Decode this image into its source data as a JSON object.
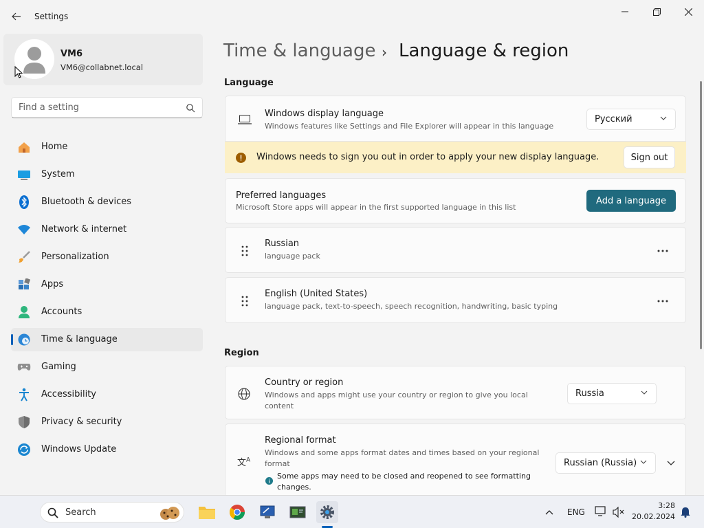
{
  "window": {
    "title": "Settings"
  },
  "user": {
    "name": "VM6",
    "email": "VM6@collabnet.local"
  },
  "search": {
    "placeholder": "Find a setting"
  },
  "sidebar": {
    "items": [
      {
        "label": "Home",
        "icon": "home-icon"
      },
      {
        "label": "System",
        "icon": "system-icon"
      },
      {
        "label": "Bluetooth & devices",
        "icon": "bluetooth-icon"
      },
      {
        "label": "Network & internet",
        "icon": "wifi-icon"
      },
      {
        "label": "Personalization",
        "icon": "brush-icon"
      },
      {
        "label": "Apps",
        "icon": "apps-icon"
      },
      {
        "label": "Accounts",
        "icon": "accounts-icon"
      },
      {
        "label": "Time & language",
        "icon": "time-language-icon",
        "active": true
      },
      {
        "label": "Gaming",
        "icon": "gamepad-icon"
      },
      {
        "label": "Accessibility",
        "icon": "accessibility-icon"
      },
      {
        "label": "Privacy & security",
        "icon": "shield-icon"
      },
      {
        "label": "Windows Update",
        "icon": "update-icon"
      }
    ]
  },
  "breadcrumb": {
    "parent": "Time & language",
    "separator": "›",
    "current": "Language & region"
  },
  "language": {
    "heading": "Language",
    "display": {
      "title": "Windows display language",
      "subtitle": "Windows features like Settings and File Explorer will appear in this language",
      "value": "Русский"
    },
    "warning": {
      "text": "Windows needs to sign you out in order to apply your new display language.",
      "button": "Sign out"
    },
    "preferred": {
      "title": "Preferred languages",
      "subtitle": "Microsoft Store apps will appear in the first supported language in this list",
      "button": "Add a language"
    },
    "list": [
      {
        "name": "Russian",
        "features": "language pack"
      },
      {
        "name": "English (United States)",
        "features": "language pack, text-to-speech, speech recognition, handwriting, basic typing"
      }
    ]
  },
  "region": {
    "heading": "Region",
    "country": {
      "title": "Country or region",
      "subtitle": "Windows and apps might use your country or region to give you local content",
      "value": "Russia"
    },
    "format": {
      "title": "Regional format",
      "subtitle": "Windows and some apps format dates and times based on your regional format",
      "value": "Russian (Russia)",
      "note": "Some apps may need to be closed and reopened to see formatting changes."
    }
  },
  "taskbar": {
    "search": "Search",
    "apps": [
      "file-explorer-icon",
      "chrome-icon",
      "remote-app-icon",
      "terminal-app-icon",
      "settings-icon"
    ],
    "tray": {
      "lang": "ENG",
      "time": "3:28",
      "date": "20.02.2024"
    }
  },
  "colors": {
    "accent": "#005fb8",
    "warning_bg": "#fcf0c6",
    "primary_button": "#206a7e"
  }
}
